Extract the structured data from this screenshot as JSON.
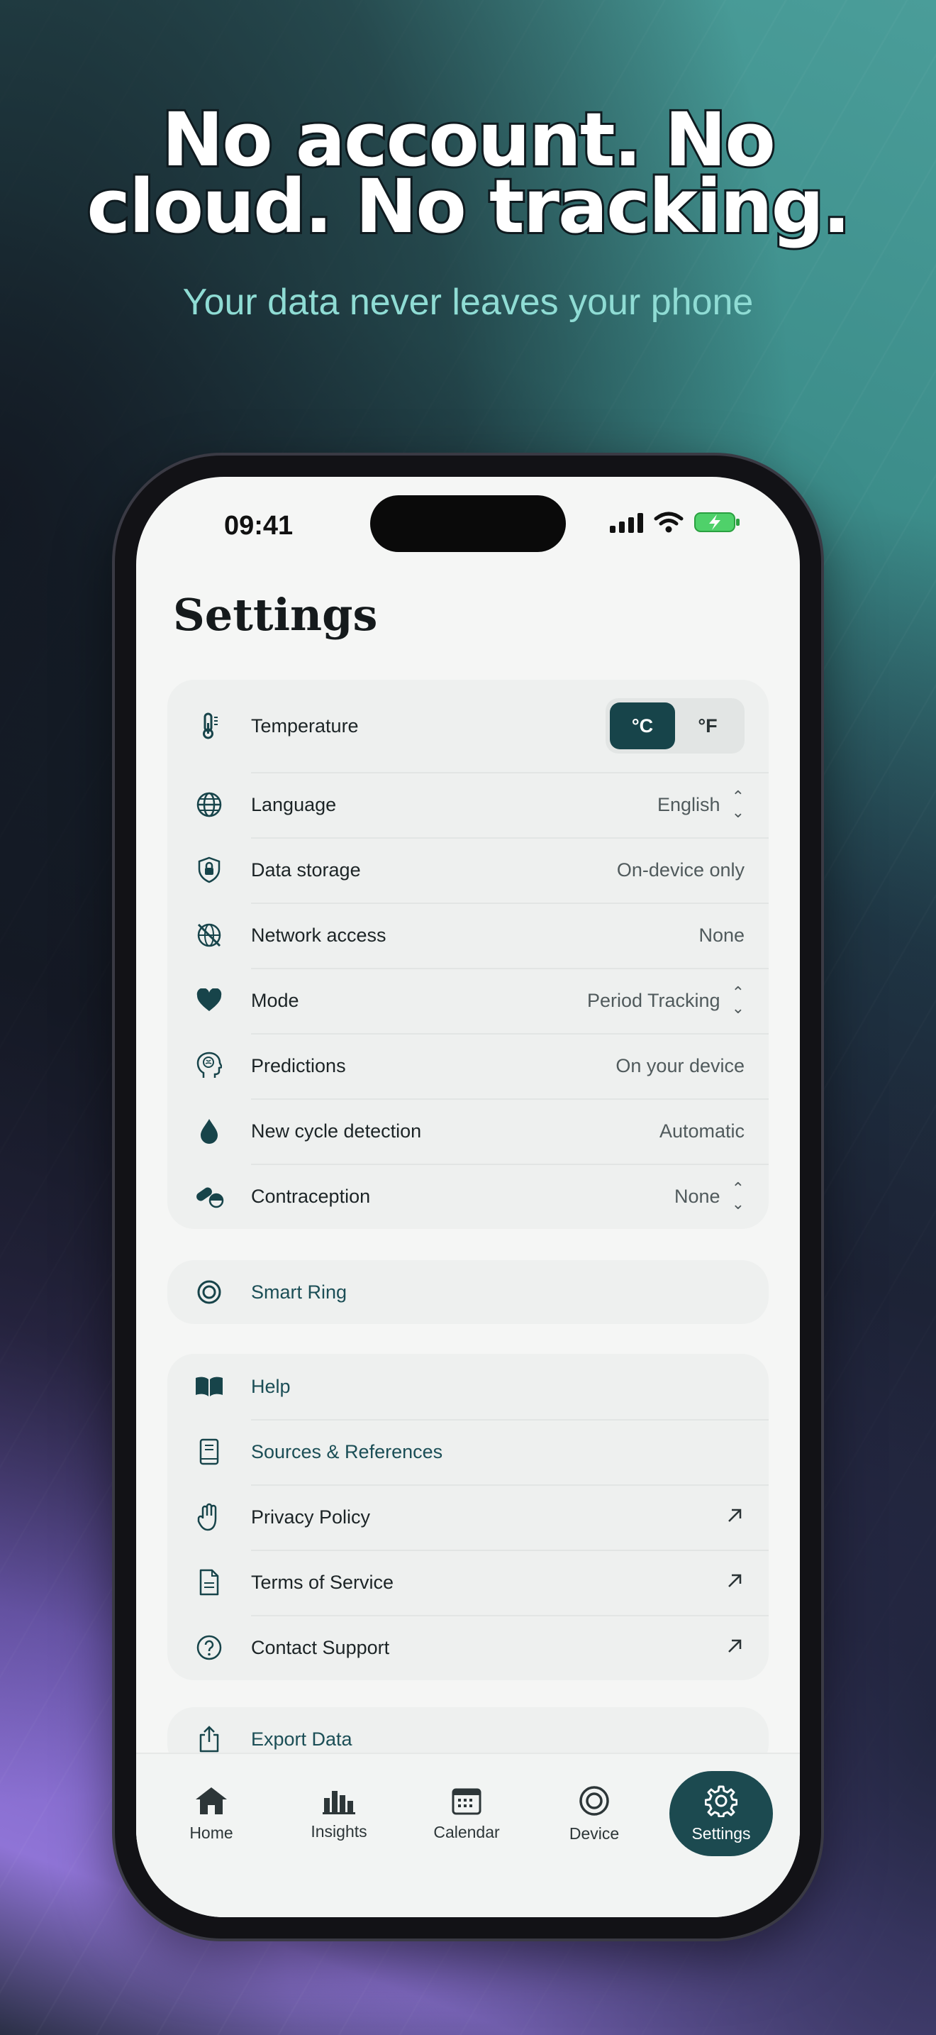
{
  "hero": {
    "headline": "No account. No cloud. No tracking.",
    "subhead": "Your data never leaves your phone"
  },
  "status_bar": {
    "time": "09:41"
  },
  "page": {
    "title": "Settings"
  },
  "settings_group": [
    {
      "id": "temperature",
      "icon": "thermometer-icon",
      "label": "Temperature",
      "options": [
        "°C",
        "°F"
      ],
      "selected": "°C"
    },
    {
      "id": "language",
      "icon": "globe-icon",
      "label": "Language",
      "value": "English",
      "selector": true
    },
    {
      "id": "data-storage",
      "icon": "shield-lock-icon",
      "label": "Data storage",
      "value": "On-device only"
    },
    {
      "id": "network-access",
      "icon": "globe-off-icon",
      "label": "Network access",
      "value": "None"
    },
    {
      "id": "mode",
      "icon": "heart-icon",
      "label": "Mode",
      "value": "Period Tracking",
      "selector": true
    },
    {
      "id": "predictions",
      "icon": "brain-head-icon",
      "label": "Predictions",
      "value": "On your device"
    },
    {
      "id": "cycle-detection",
      "icon": "drop-icon",
      "label": "New cycle detection",
      "value": "Automatic"
    },
    {
      "id": "contraception",
      "icon": "pill-icon",
      "label": "Contraception",
      "value": "None",
      "selector": true
    }
  ],
  "device_group": [
    {
      "id": "smart-ring",
      "icon": "ring-icon",
      "label": "Smart Ring"
    }
  ],
  "info_group": [
    {
      "id": "help",
      "icon": "book-open-icon",
      "label": "Help"
    },
    {
      "id": "sources",
      "icon": "book-icon",
      "label": "Sources & References"
    },
    {
      "id": "privacy",
      "icon": "hand-icon",
      "label": "Privacy Policy",
      "external": true
    },
    {
      "id": "terms",
      "icon": "document-icon",
      "label": "Terms of Service",
      "external": true
    },
    {
      "id": "support",
      "icon": "question-circle-icon",
      "label": "Contact Support",
      "external": true
    }
  ],
  "export_group": [
    {
      "id": "export",
      "icon": "share-icon",
      "label": "Export Data"
    }
  ],
  "tab_bar": [
    {
      "id": "home",
      "icon": "home-icon",
      "label": "Home"
    },
    {
      "id": "insights",
      "icon": "bar-chart-icon",
      "label": "Insights"
    },
    {
      "id": "calendar",
      "icon": "calendar-icon",
      "label": "Calendar"
    },
    {
      "id": "device",
      "icon": "ring-icon",
      "label": "Device"
    },
    {
      "id": "settings",
      "icon": "gear-icon",
      "label": "Settings",
      "active": true
    }
  ],
  "colors": {
    "accent": "#1c4a50",
    "text_teal": "#1b4e56",
    "subhead": "#8fdcd4"
  }
}
